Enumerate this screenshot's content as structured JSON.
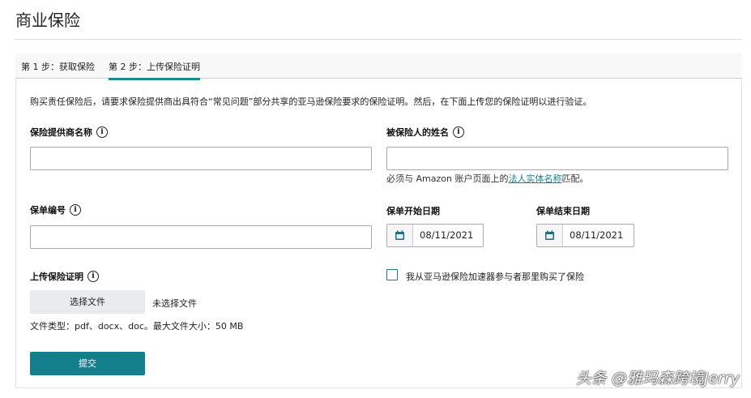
{
  "page": {
    "title": "商业保险"
  },
  "tabs": [
    {
      "label": "第 1 步：获取保险"
    },
    {
      "label": "第 2 步：上传保险证明",
      "active": true
    }
  ],
  "intro": "购买责任保险后，请要求保险提供商出具符合“常见问题”部分共享的亚马逊保险要求的保险证明。然后，在下面上传您的保险证明以进行验证。",
  "form": {
    "provider_label": "保险提供商名称",
    "provider_value": "",
    "insured_label": "被保险人的姓名",
    "insured_value": "",
    "insured_help_pre": "必须与 Amazon 账户页面上的",
    "insured_help_link": "法人实体名称",
    "insured_help_post": "匹配。",
    "policy_label": "保单编号",
    "policy_value": "",
    "start_label": "保单开始日期",
    "start_value": "08/11/2021",
    "end_label": "保单结束日期",
    "end_value": "08/11/2021",
    "upload_label": "上传保险证明",
    "choose_file": "选择文件",
    "no_file": "未选择文件",
    "file_info": "文件类型：pdf、docx、doc。最大文件大小：50 MB",
    "accelerator_label": "我从亚马逊保险加速器参与者那里购买了保险",
    "accelerator_checked": false,
    "submit": "提交"
  },
  "info_icon": "i",
  "watermark": "头条 @雅玛森跨境Jerry",
  "colors": {
    "accent": "#1b8a8f",
    "submit": "#137f8c"
  }
}
